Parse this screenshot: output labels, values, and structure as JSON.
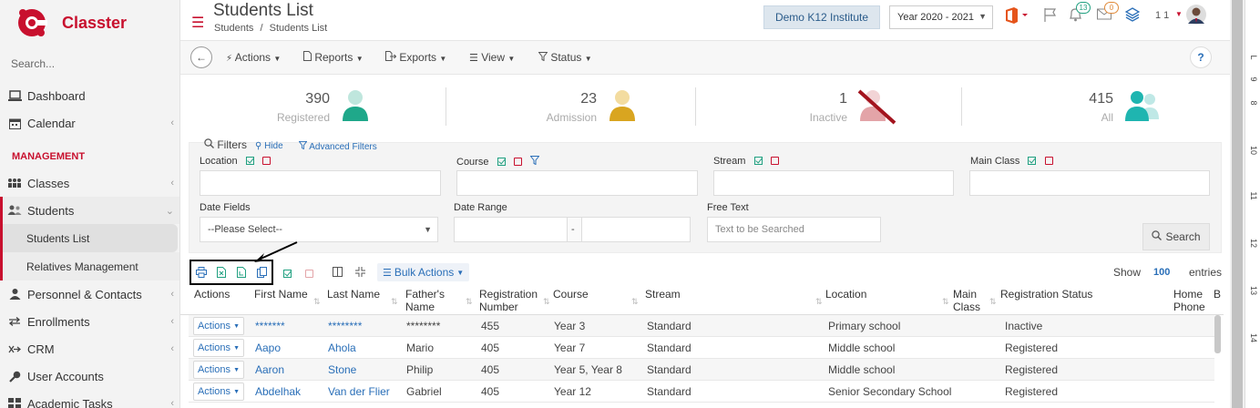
{
  "app": {
    "name": "Classter"
  },
  "sidebar": {
    "search_placeholder": "Search...",
    "items": [
      {
        "label": "Dashboard",
        "icon": "laptop-icon"
      },
      {
        "label": "Calendar",
        "icon": "calendar-icon"
      }
    ],
    "section_label": "MANAGEMENT",
    "management": [
      {
        "label": "Classes",
        "icon": "classes-icon"
      },
      {
        "label": "Students",
        "icon": "students-icon"
      }
    ],
    "students_sub": [
      {
        "label": "Students List"
      },
      {
        "label": "Relatives Management"
      }
    ],
    "more": [
      {
        "label": "Personnel & Contacts",
        "icon": "person-icon"
      },
      {
        "label": "Enrollments",
        "icon": "arrows-icon"
      },
      {
        "label": "CRM",
        "icon": "crm-icon"
      },
      {
        "label": "User Accounts",
        "icon": "key-icon"
      },
      {
        "label": "Academic Tasks",
        "icon": "grid-icon"
      }
    ]
  },
  "header": {
    "title": "Students List",
    "breadcrumb": [
      "Students",
      "/",
      "Students List"
    ],
    "institute": "Demo K12 Institute",
    "year": "Year 2020 - 2021",
    "notifications_count": "13",
    "messages_count": "0",
    "user_label": "1 1"
  },
  "toolbar": {
    "actions": "Actions",
    "reports": "Reports",
    "exports": "Exports",
    "view": "View",
    "status": "Status",
    "help": "?"
  },
  "stats": [
    {
      "value": "390",
      "label": "Registered",
      "color": "#1fa88a"
    },
    {
      "value": "23",
      "label": "Admission",
      "color": "#d9a520"
    },
    {
      "value": "1",
      "label": "Inactive",
      "color": "#e3a4a8"
    },
    {
      "value": "415",
      "label": "All",
      "color": "#1fb5b0"
    }
  ],
  "filters": {
    "title": "Filters",
    "hide": "Hide",
    "advanced": "Advanced Filters",
    "location_label": "Location",
    "course_label": "Course",
    "stream_label": "Stream",
    "main_class_label": "Main Class",
    "date_fields_label": "Date Fields",
    "date_fields_value": "--Please Select--",
    "date_range_label": "Date Range",
    "date_range_sep": "-",
    "free_text_label": "Free Text",
    "free_text_placeholder": "Text to be Searched",
    "search_button": "Search"
  },
  "table_toolbar": {
    "bulk_actions": "Bulk Actions",
    "show": "Show",
    "page_size": "100",
    "entries": "entries"
  },
  "table": {
    "columns": [
      "Actions",
      "First Name",
      "Last Name",
      "Father's Name",
      "Registration Number",
      "Course",
      "Stream",
      "Location",
      "Main Class",
      "Registration Status",
      "Home Phone",
      "B"
    ],
    "action_label": "Actions",
    "rows": [
      {
        "first": "*******",
        "last": "********",
        "father": "********",
        "reg": "455",
        "course": "Year 3",
        "stream": "Standard",
        "location": "Primary school",
        "main_class": "",
        "status": "Inactive"
      },
      {
        "first": "Aapo",
        "last": "Ahola",
        "father": "Mario",
        "reg": "405",
        "course": "Year 7",
        "stream": "Standard",
        "location": "Middle school",
        "main_class": "",
        "status": "Registered"
      },
      {
        "first": "Aaron",
        "last": "Stone",
        "father": "Philip",
        "reg": "405",
        "course": "Year 5, Year 8",
        "stream": "Standard",
        "location": "Middle school",
        "main_class": "",
        "status": "Registered"
      },
      {
        "first": "Abdelhak",
        "last": "Van der Flier",
        "father": "Gabriel",
        "reg": "405",
        "course": "Year 12",
        "stream": "Standard",
        "location": "Senior Secondary School",
        "main_class": "",
        "status": "Registered"
      }
    ]
  },
  "ruler": [
    "L",
    "9",
    "8",
    "10",
    "11",
    "12",
    "13",
    "14"
  ]
}
